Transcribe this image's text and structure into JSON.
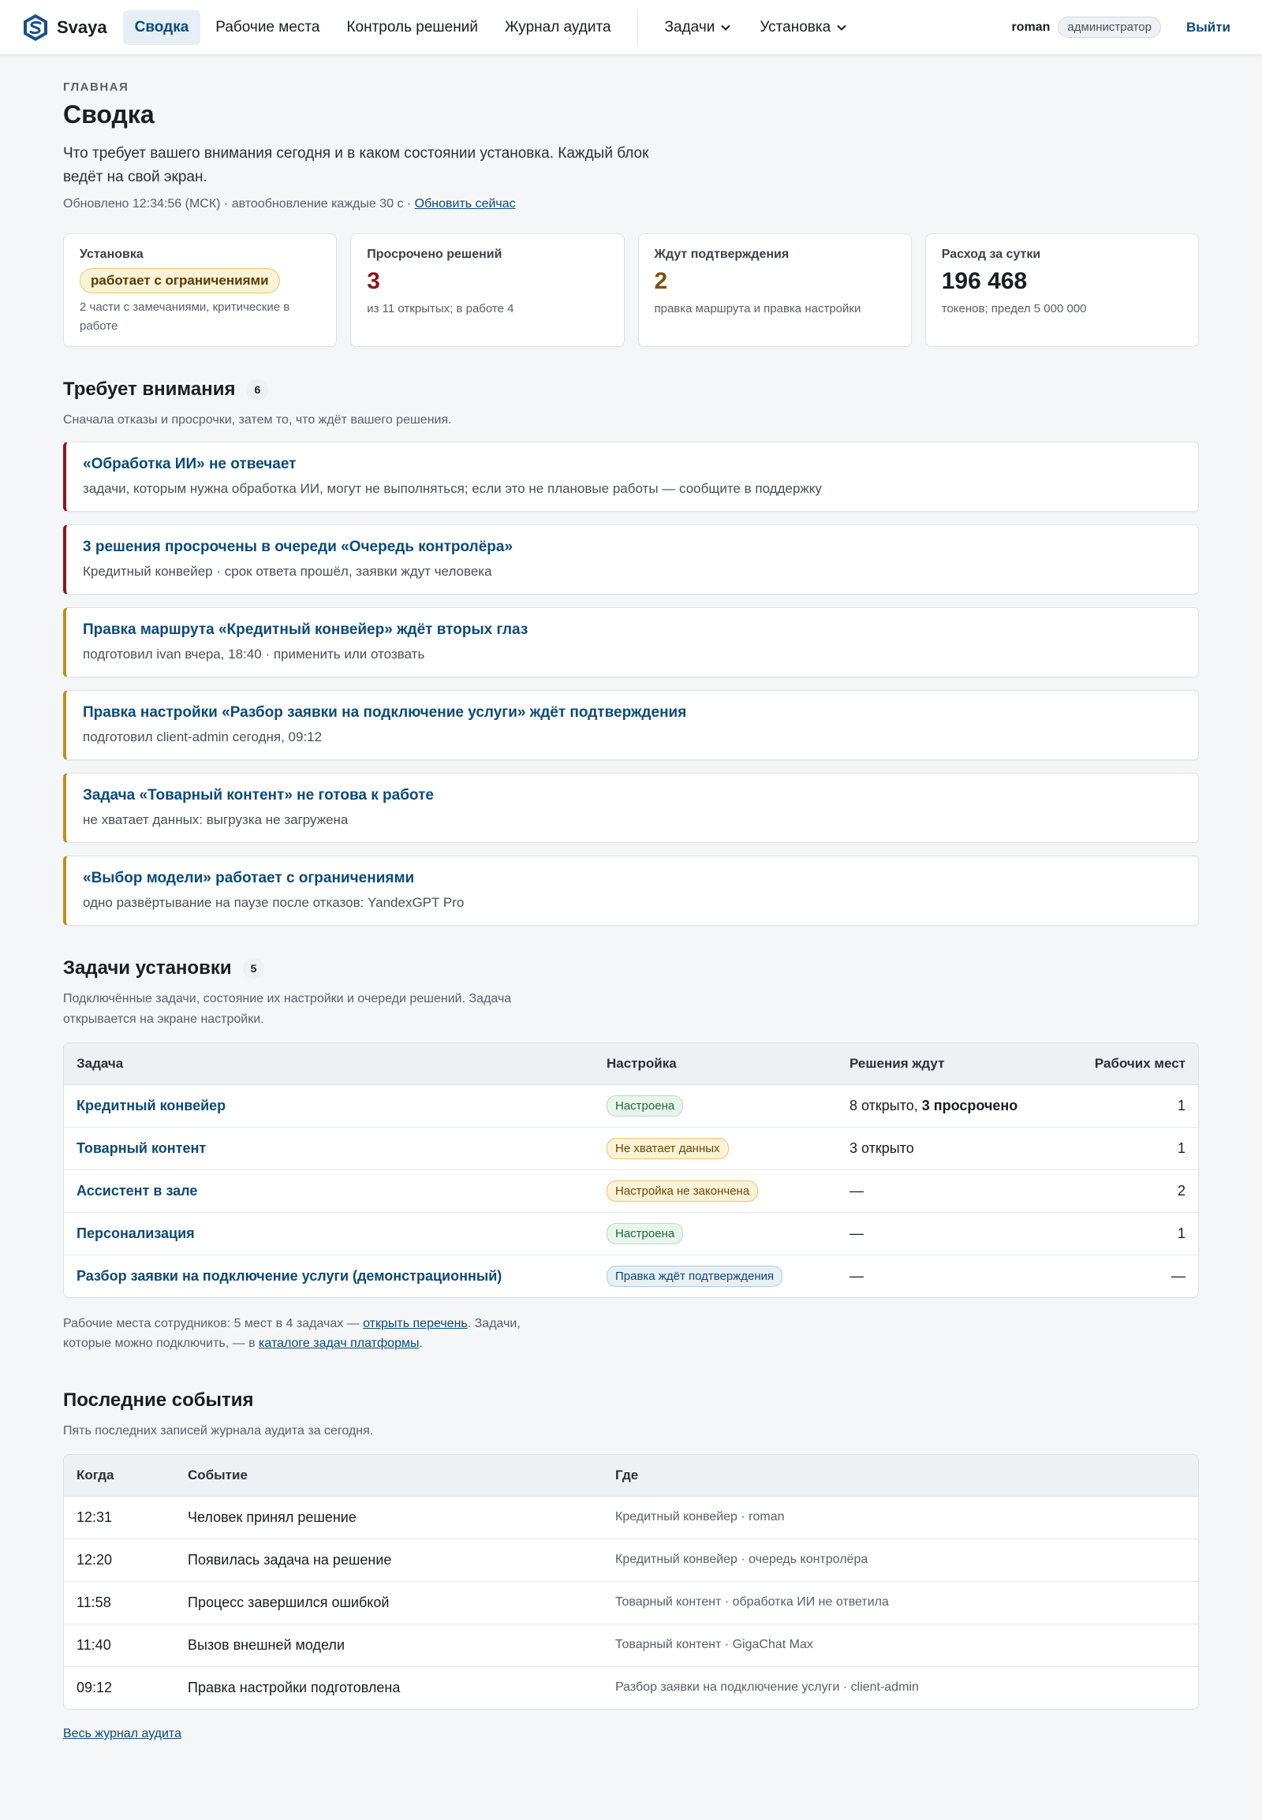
{
  "app": {
    "brand": "Svaya",
    "nav": [
      {
        "label": "Сводка"
      },
      {
        "label": "Рабочие места"
      },
      {
        "label": "Контроль решений"
      },
      {
        "label": "Журнал аудита"
      }
    ],
    "nav_dropdowns": [
      {
        "label": "Задачи"
      },
      {
        "label": "Установка"
      }
    ],
    "user": "roman",
    "role": "администратор",
    "logout": "Выйти"
  },
  "page": {
    "eyebrow": "ГЛАВНАЯ",
    "title": "Сводка",
    "lead": "Что требует вашего внимания сегодня и в каком состоянии установка. Каждый блок ведёт на свой экран.",
    "updated": "Обновлено 12:34:56 (МСК) · автообновление каждые 30 с ·",
    "refresh": "Обновить сейчас"
  },
  "kpis": {
    "install": {
      "label": "Установка",
      "state": "работает с ограничениями",
      "note": "2 части с замечаниями, критические в работе"
    },
    "overdue": {
      "label": "Просрочено решений",
      "value": "3",
      "note": "из 11 открытых; в работе 4"
    },
    "pending": {
      "label": "Ждут подтверждения",
      "value": "2",
      "note": "правка маршрута и правка настройки"
    },
    "usage": {
      "label": "Расход за сутки",
      "value": "196 468",
      "note": "токенов; предел 5 000 000"
    }
  },
  "attention": {
    "title": "Требует внимания",
    "count": "6",
    "desc": "Сначала отказы и просрочки, затем то, что ждёт вашего решения.",
    "items": [
      {
        "title": "«Обработка ИИ» не отвечает",
        "text": "задачи, которым нужна обработка ИИ, могут не выполняться; если это не плановые работы — сообщите в поддержку"
      },
      {
        "title": "3 решения просрочены в очереди «Очередь контролёра»",
        "text": "Кредитный конвейер · срок ответа прошёл, заявки ждут человека"
      },
      {
        "title": "Правка маршрута «Кредитный конвейер» ждёт вторых глаз",
        "text": "подготовил ivan вчера, 18:40 · применить или отозвать"
      },
      {
        "title": "Правка настройки «Разбор заявки на подключение услуги» ждёт подтверждения",
        "text": "подготовил client-admin сегодня, 09:12"
      },
      {
        "title": "Задача «Товарный контент» не готова к работе",
        "text": "не хватает данных: выгрузка не загружена"
      },
      {
        "title": "«Выбор модели» работает с ограничениями",
        "text": "одно развёртывание на паузе после отказов: YandexGPT Pro"
      }
    ]
  },
  "tasks": {
    "title": "Задачи установки",
    "count": "5",
    "desc": "Подключённые задачи, состояние их настройки и очереди решений. Задача открывается на экране настройки.",
    "columns": [
      "Задача",
      "Настройка",
      "Решения ждут",
      "Рабочих мест"
    ],
    "rows": [
      {
        "name": "Кредитный конвейер",
        "status": "Настроена",
        "waiting": "8 открыто, ",
        "waiting_bold": "3 просрочено",
        "seats": "1"
      },
      {
        "name": "Товарный контент",
        "status": "Не хватает данных",
        "waiting": "3 открыто",
        "waiting_bold": "",
        "seats": "1"
      },
      {
        "name": "Ассистент в зале",
        "status": "Настройка не закончена",
        "waiting": "—",
        "waiting_bold": "",
        "seats": "2"
      },
      {
        "name": "Персонализация",
        "status": "Настроена",
        "waiting": "—",
        "waiting_bold": "",
        "seats": "1"
      },
      {
        "name": "Разбор заявки на подключение услуги (демонстрационный)",
        "status": "Правка ждёт подтверждения",
        "waiting": "—",
        "waiting_bold": "",
        "seats": "—"
      }
    ],
    "note_a": "Рабочие места сотрудников: 5 мест в 4 задачах — ",
    "note_link1": "открыть перечень",
    "note_b": ". Задачи, которые можно подключить, — в ",
    "note_link2": "каталоге задач платформы",
    "note_c": "."
  },
  "events": {
    "title": "Последние события",
    "desc": "Пять последних записей журнала аудита за сегодня.",
    "columns": [
      "Когда",
      "Событие",
      "Где"
    ],
    "rows": [
      {
        "time": "12:31",
        "event": "Человек принял решение",
        "where": "Кредитный конвейер · roman"
      },
      {
        "time": "12:20",
        "event": "Появилась задача на решение",
        "where": "Кредитный конвейер · очередь контролёра"
      },
      {
        "time": "11:58",
        "event": "Процесс завершился ошибкой",
        "where": "Товарный контент · обработка ИИ не ответила"
      },
      {
        "time": "11:40",
        "event": "Вызов внешней модели",
        "where": "Товарный контент · GigaChat Max"
      },
      {
        "time": "09:12",
        "event": "Правка настройки подготовлена",
        "where": "Разбор заявки на подключение услуги · client-admin"
      }
    ],
    "all_link": "Весь журнал аудита"
  }
}
